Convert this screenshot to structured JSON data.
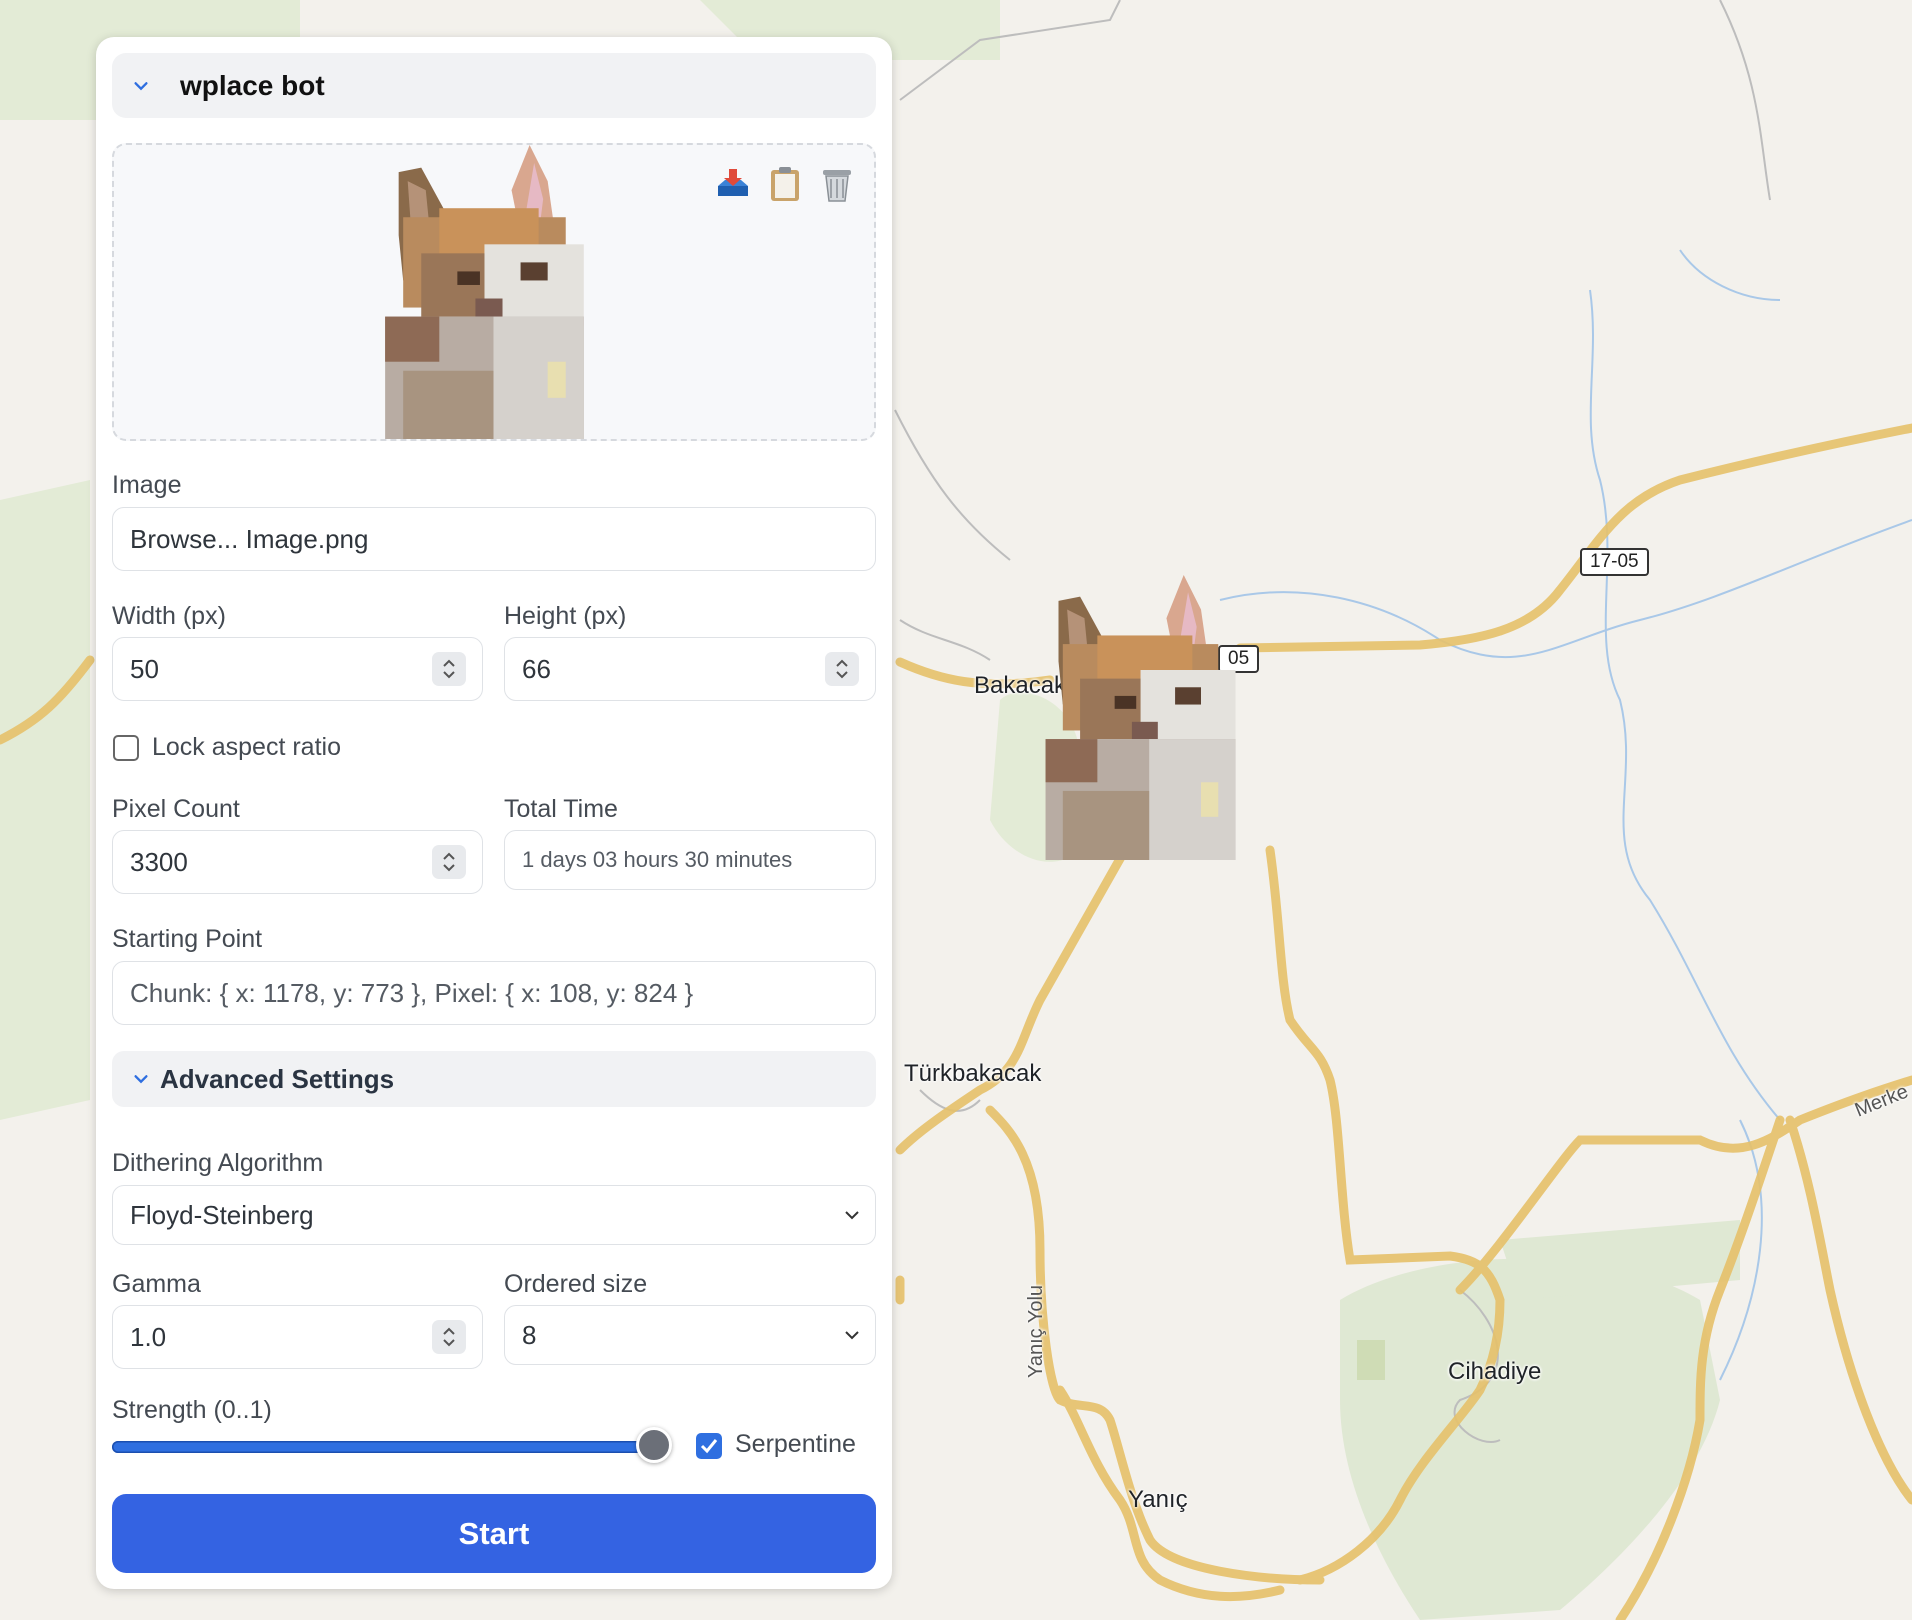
{
  "map": {
    "labels": {
      "bakacak": "Bakacak",
      "turkbakacak": "Türkbakacak",
      "cihadiye": "Cihadiye",
      "yanic": "Yanıç",
      "yanic_yolu": "Yanıç Yolu",
      "merke": "Merke"
    },
    "road_shields": {
      "r1": "17-05",
      "r2": "05"
    }
  },
  "panel": {
    "title": "wplace bot",
    "preview_tools": {
      "import_icon": "import-tray-icon",
      "clipboard_icon": "clipboard-icon",
      "trash_icon": "trash-icon"
    },
    "image": {
      "label": "Image",
      "value": "Browse... Image.png"
    },
    "width": {
      "label": "Width (px)",
      "value": "50"
    },
    "height": {
      "label": "Height (px)",
      "value": "66"
    },
    "lock_aspect": {
      "label": "Lock aspect ratio",
      "checked": false
    },
    "pixel_count": {
      "label": "Pixel Count",
      "value": "3300"
    },
    "total_time": {
      "label": "Total Time",
      "value": "1 days 03 hours 30 minutes"
    },
    "starting_point": {
      "label": "Starting Point",
      "value": "Chunk: { x: 1178, y: 773 }, Pixel: { x: 108, y: 824 }"
    },
    "advanced": {
      "title": "Advanced Settings",
      "dithering": {
        "label": "Dithering Algorithm",
        "value": "Floyd-Steinberg"
      },
      "gamma": {
        "label": "Gamma",
        "value": "1.0"
      },
      "ordered_size": {
        "label": "Ordered size",
        "value": "8"
      },
      "strength": {
        "label": "Strength (0..1)",
        "value": 1.0
      },
      "serpentine": {
        "label": "Serpentine",
        "checked": true
      }
    },
    "start_label": "Start"
  },
  "colors": {
    "accent": "#3463e2",
    "road": "#f7d37a",
    "forest": "#dfe8d3"
  }
}
